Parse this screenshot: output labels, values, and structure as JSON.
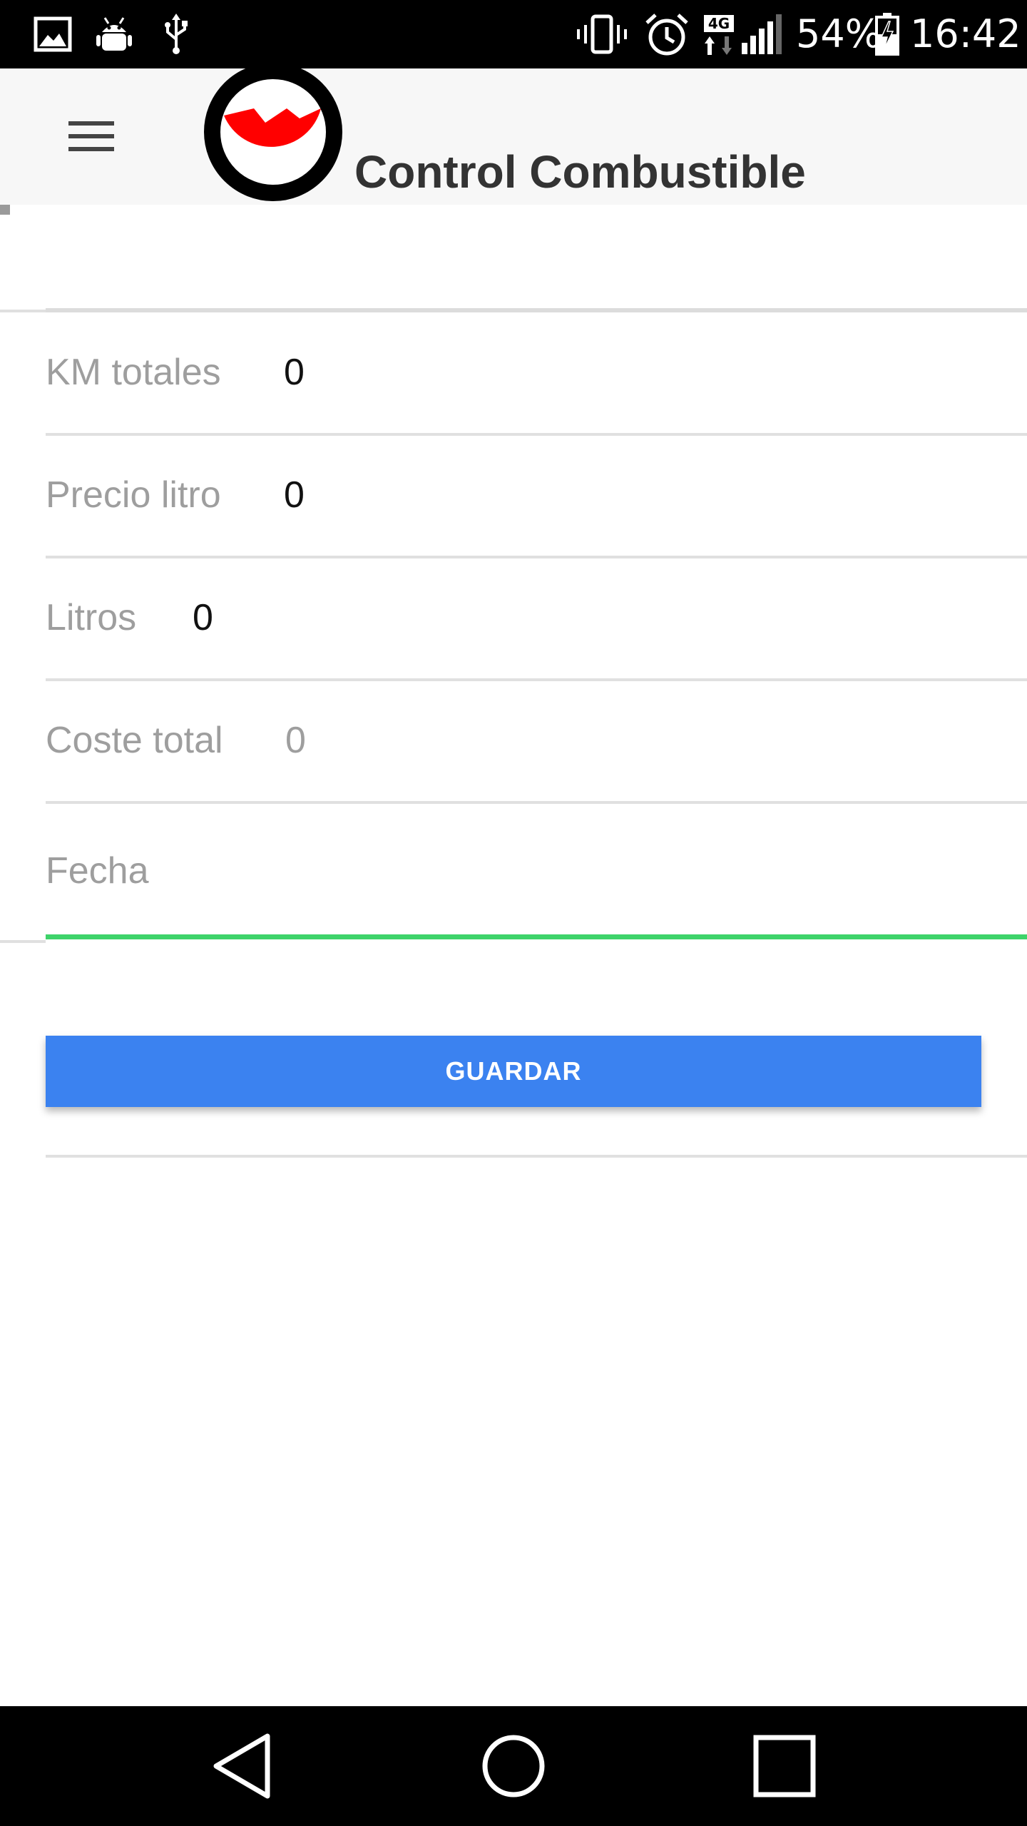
{
  "status_bar": {
    "battery_percent": "54%",
    "time": "16:42",
    "network_type": "4G",
    "icons": [
      "image-icon",
      "android-debug-icon",
      "usb-icon",
      "vibrate-icon",
      "alarm-icon",
      "network-4g-icon",
      "signal-icon",
      "battery-charging-icon"
    ]
  },
  "app_bar": {
    "title": "Control Combustible",
    "menu_icon": "hamburger-menu-icon",
    "logo": "fuel-gauge-logo"
  },
  "form": {
    "fields": [
      {
        "label": "KM totales",
        "value": "0"
      },
      {
        "label": "Precio litro",
        "value": "0"
      },
      {
        "label": "Litros",
        "value": "0"
      },
      {
        "label": "Coste total",
        "value": "0"
      },
      {
        "label": "Fecha",
        "value": ""
      }
    ],
    "save_label": "GUARDAR",
    "focus_color": "#3ed36a",
    "button_color": "#3b82f0"
  },
  "nav_bar": {
    "icons": [
      "back-icon",
      "home-icon",
      "recents-icon"
    ]
  }
}
